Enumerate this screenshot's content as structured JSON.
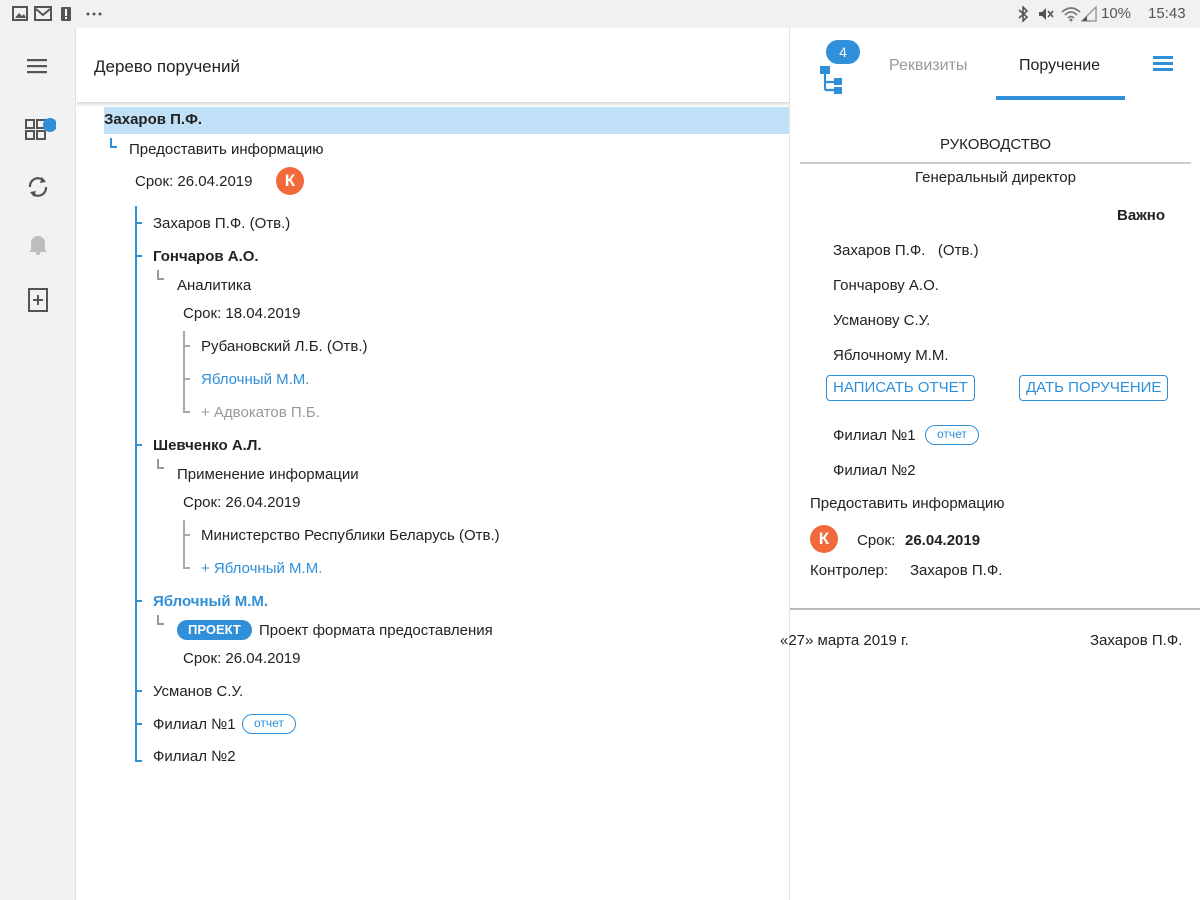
{
  "status_bar": {
    "icons": [
      "image-icon",
      "gmail-icon",
      "alert-icon",
      "more-icon",
      "bluetooth-icon",
      "mute-icon",
      "wifi-icon",
      "signal-icon"
    ],
    "battery": "10%",
    "time": "15:43"
  },
  "rail": {
    "items": [
      "menu-icon",
      "dashboard-icon",
      "sync-icon",
      "bell-icon",
      "add-document-icon"
    ]
  },
  "header": {
    "title": "Дерево поручений"
  },
  "tree": {
    "root": "Захаров П.Ф.",
    "task": "Предоставить информацию",
    "deadline": "Срок: 26.04.2019",
    "k_badge": "К",
    "n1": "Захаров П.Ф. (Отв.)",
    "n2": "Гончаров А.О.",
    "n2_task": "Аналитика",
    "n2_deadline": "Срок: 18.04.2019",
    "n2_c1": "Рубановский Л.Б. (Отв.)",
    "n2_c2": "Яблочный М.М.",
    "n2_c3": "+ Адвокатов П.Б.",
    "n3": "Шевченко А.Л.",
    "n3_task": "Применение информации",
    "n3_deadline": "Срок: 26.04.2019",
    "n3_c1": "Министерство Республики Беларусь (Отв.)",
    "n3_c2": "+ Яблочный М.М.",
    "n4": "Яблочный М.М.",
    "n4_chip": "ПРОЕКТ",
    "n4_task": "Проект формата предоставления",
    "n4_deadline": "Срок: 26.04.2019",
    "n5": "Усманов С.У.",
    "n6": "Филиал №1",
    "n6_chip": "отчет",
    "n7": "Филиал №2"
  },
  "right_panel": {
    "badge_count": "4",
    "tabs": [
      "Реквизиты",
      "Поручение"
    ],
    "active_tab": "Поручение",
    "section": "РУКОВОДСТВО",
    "position": "Генеральный директор",
    "important": "Важно",
    "addressees": [
      "Захаров П.Ф.   (Отв.)",
      "Гончарову А.О.",
      "Усманову С.У.",
      "Яблочному М.М."
    ],
    "write_report": "НАПИСАТЬ ОТЧЕТ",
    "give_task": "ДАТЬ ПОРУЧЕНИЕ",
    "branch1": "Филиал №1",
    "branch1_chip": "отчет",
    "branch2": "Филиал №2",
    "task": "Предоставить информацию",
    "k_badge": "К",
    "deadline_label": "Срок:",
    "deadline_value": "26.04.2019",
    "controller_label": "Контролер:",
    "controller_value": "Захаров П.Ф.",
    "date": "«27» марта 2019 г.",
    "signer": "Захаров П.Ф."
  }
}
